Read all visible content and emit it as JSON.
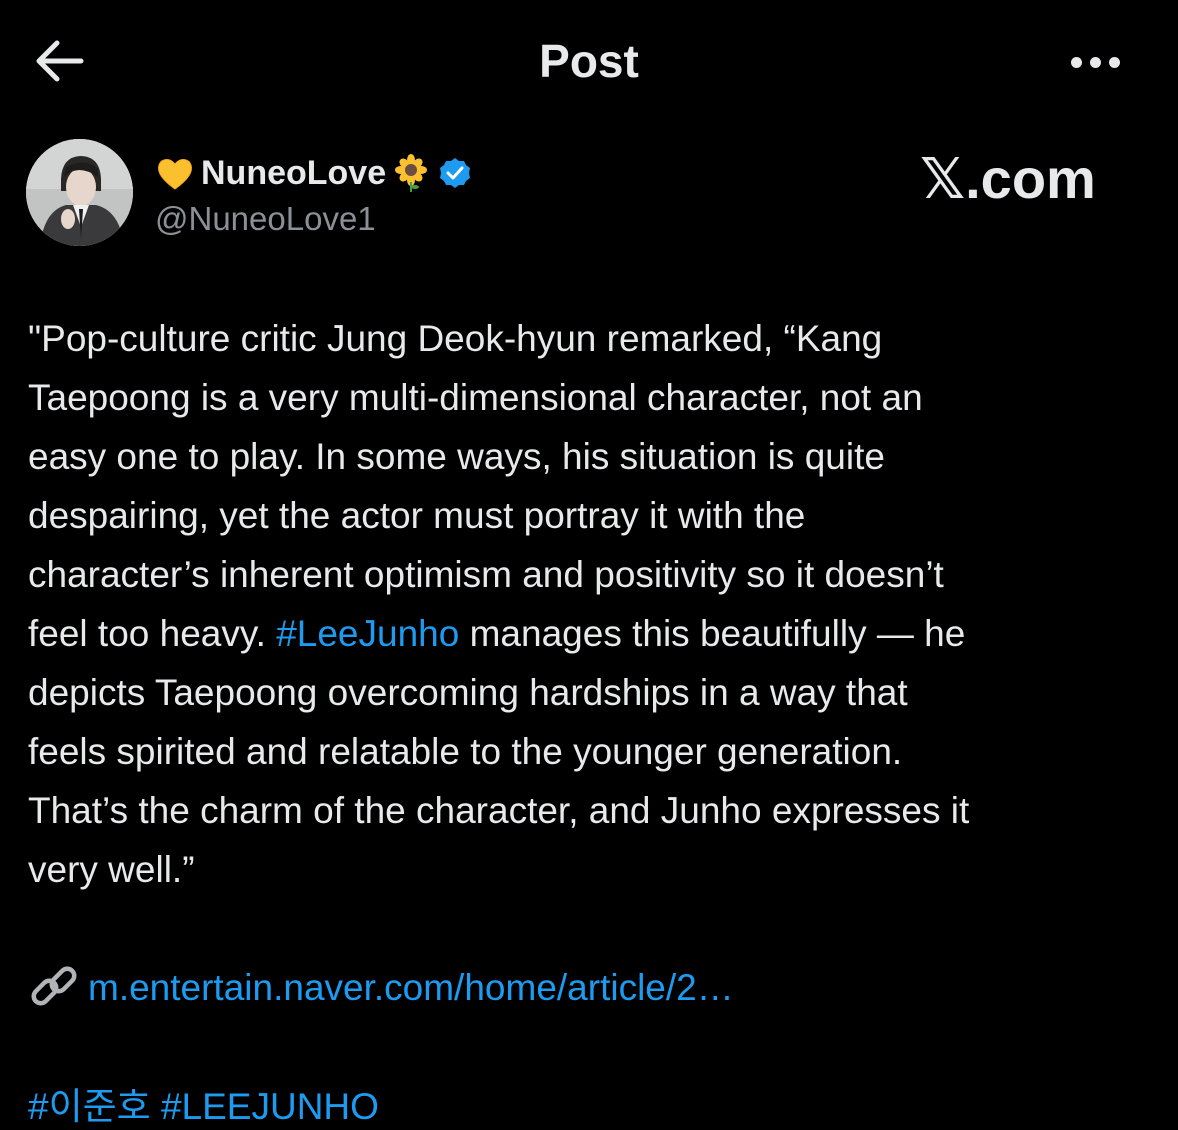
{
  "header": {
    "title": "Post",
    "back_icon": "arrow-left-icon",
    "more_icon": "more-horizontal-icon"
  },
  "author": {
    "display_name": "NuneoLove",
    "handle": "@NuneoLove1",
    "name_prefix_emoji": "yellow-heart-icon",
    "name_suffix_emoji": "sunflower-icon",
    "verified": true
  },
  "watermark": "𝕏.com",
  "tweet": {
    "lines": [
      "\"Pop-culture critic Jung Deok-hyun remarked, “Kang",
      "Taepoong is a very multi-dimensional character, not an",
      "easy one to play. In some ways, his situation is quite",
      "despairing, yet the actor must portray it with the",
      "character’s inherent optimism and positivity so it doesn’t",
      "feel too heavy. ",
      "#LeeJunho",
      " manages this beautifully — he",
      "depicts Taepoong overcoming hardships in a way that",
      "feels spirited and relatable to the younger generation.",
      "That’s the charm of the character, and Junho expresses it",
      "very well.”"
    ],
    "link_url": "m.entertain.naver.com/home/article/2…",
    "tags": "#이준호 #LEEJUNHO"
  },
  "colors": {
    "background": "#000000",
    "text": "#e7e9ea",
    "secondary": "#8b9096",
    "accent": "#1d9bf0"
  }
}
